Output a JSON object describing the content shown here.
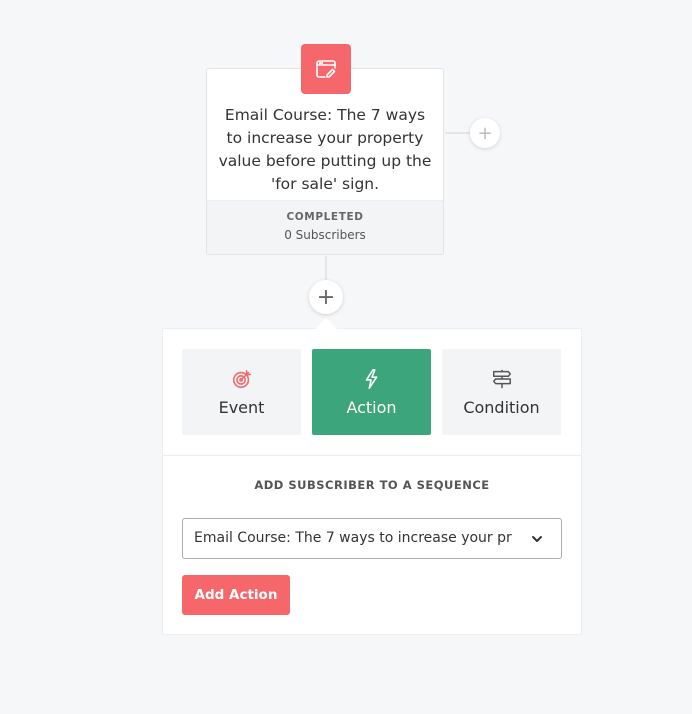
{
  "node": {
    "icon": "browser-edit-icon",
    "title": "Email Course: The 7 ways to increase your property value before putting up the 'for sale' sign.",
    "status": "COMPLETED",
    "subscribers": "0 Subscribers"
  },
  "add_symbol": "+",
  "panel": {
    "types": [
      {
        "label": "Event",
        "icon": "target-icon",
        "active": false
      },
      {
        "label": "Action",
        "icon": "lightning-icon",
        "active": true
      },
      {
        "label": "Condition",
        "icon": "signpost-icon",
        "active": false
      }
    ],
    "section_title": "ADD SUBSCRIBER TO A SEQUENCE",
    "select_value": "Email Course: The 7 ways to increase your prop...",
    "button_label": "Add Action"
  },
  "colors": {
    "accent_red": "#f5676b",
    "accent_green": "#3da57b",
    "background": "#f6f7f9"
  }
}
